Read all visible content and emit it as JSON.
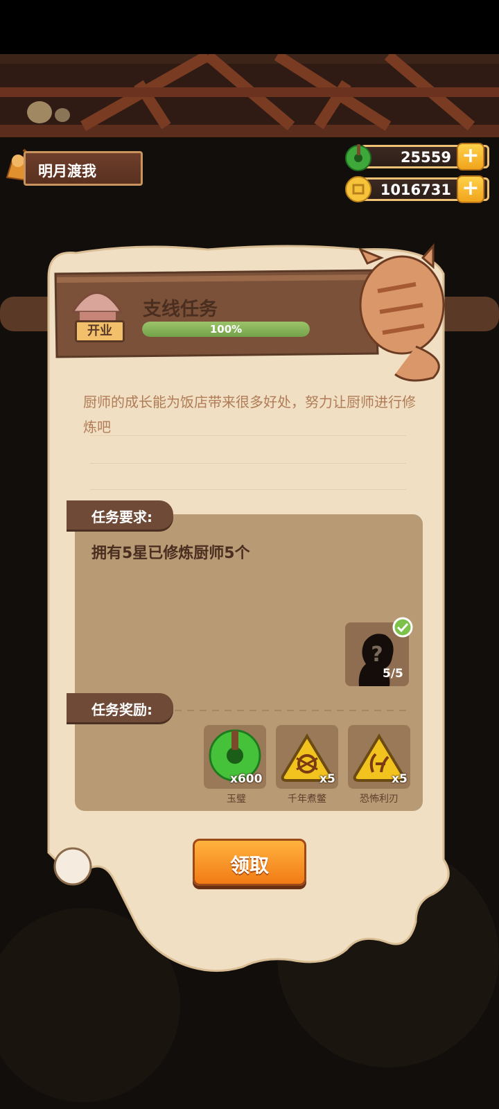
{
  "player": {
    "name": "明月渡我"
  },
  "currency": [
    {
      "icon": "jade-icon",
      "value": "25559"
    },
    {
      "icon": "coin-icon",
      "value": "1016731"
    }
  ],
  "quest": {
    "title": "支线任务",
    "badge": "开业",
    "progress_percent": 100,
    "progress_label": "100%",
    "description": "厨师的成长能为饭店带来很多好处，努力让厨师进行修炼吧",
    "requirement_header": "任务要求:",
    "requirement_text": "拥有5星已修炼厨师5个",
    "chef_count": "5/5",
    "reward_header": "任务奖励:",
    "rewards": [
      {
        "qty": "x600",
        "name": "玉璧",
        "icon": "jade-disc-icon"
      },
      {
        "qty": "x5",
        "name": "千年煮鳖",
        "icon": "turtle-ingredient-icon"
      },
      {
        "qty": "x5",
        "name": "恐怖利刃",
        "icon": "blade-ingredient-icon"
      }
    ],
    "claim_label": "领取"
  },
  "colors": {
    "parchment": "#f0dfc2",
    "progress_green": "#8ab85a",
    "button_orange": "#f6901f",
    "panel_brown": "#b89a75"
  }
}
